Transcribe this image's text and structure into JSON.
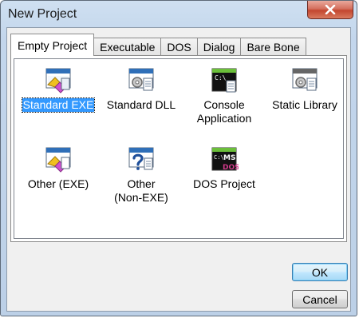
{
  "window": {
    "title": "New Project",
    "close_glyph": "✕"
  },
  "tabs": [
    {
      "label": "Empty Project",
      "active": true
    },
    {
      "label": "Executable",
      "active": false
    },
    {
      "label": "DOS",
      "active": false
    },
    {
      "label": "Dialog",
      "active": false
    },
    {
      "label": "Bare Bone",
      "active": false
    }
  ],
  "templates": [
    {
      "line1": "Standard EXE",
      "line2": "",
      "icon": "standard-exe-icon",
      "selected": true
    },
    {
      "line1": "Standard DLL",
      "line2": "",
      "icon": "standard-dll-icon",
      "selected": false
    },
    {
      "line1": "Console",
      "line2": "Application",
      "icon": "console-app-icon",
      "selected": false
    },
    {
      "line1": "Static Library",
      "line2": "",
      "icon": "static-library-icon",
      "selected": false
    },
    {
      "line1": "Other (EXE)",
      "line2": "",
      "icon": "other-exe-icon",
      "selected": false
    },
    {
      "line1": "Other",
      "line2": "(Non-EXE)",
      "icon": "other-non-exe-icon",
      "selected": false
    },
    {
      "line1": "DOS Project",
      "line2": "",
      "icon": "dos-project-icon",
      "selected": false
    }
  ],
  "console_icon_text": "C:\\",
  "dos_icon_text": {
    "ms": "MS",
    "dos": "DOS"
  },
  "buttons": {
    "ok": "OK",
    "cancel": "Cancel"
  },
  "colors": {
    "selection": "#3399ff",
    "title_bar": "#c3d6ec",
    "close_button": "#c3462f"
  }
}
